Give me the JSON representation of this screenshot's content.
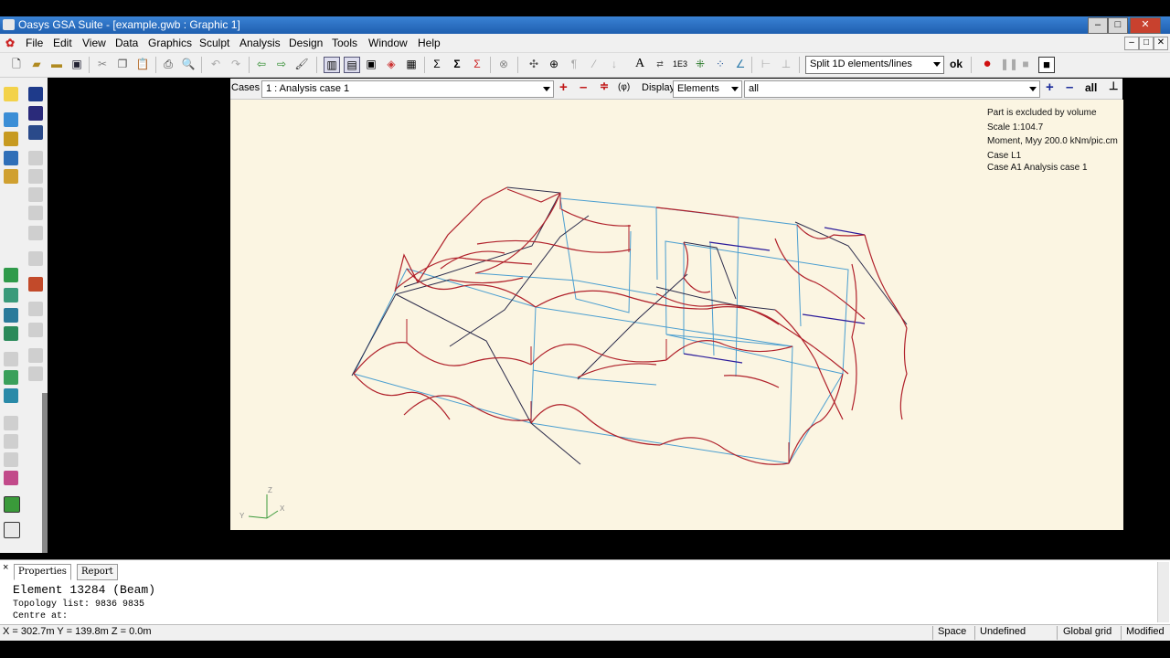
{
  "window": {
    "title": "Oasys GSA Suite - [example.gwb : Graphic 1]",
    "minimize": "–",
    "maximize": "□",
    "close": "✕"
  },
  "menu": [
    "File",
    "Edit",
    "View",
    "Data",
    "Graphics",
    "Sculpt",
    "Analysis",
    "Design",
    "Tools",
    "Window",
    "Help"
  ],
  "toolbar": {
    "split_select": "Split 1D elements/lines",
    "ok_label": "ok",
    "text_tool": "A",
    "grid_value": "1E3",
    "sigma": "Σ"
  },
  "graphic_bar": {
    "cases_label": "Cases",
    "cases_value": "1 : Analysis case 1",
    "display_label": "Display",
    "display_value": "Elements",
    "filter_value": "all",
    "all_label": "all",
    "plus": "+",
    "minus": "–",
    "pin": "⊥"
  },
  "viewport": {
    "info": [
      "Part is excluded by volume",
      "Scale  1:104.7",
      "Moment, Myy  200.0 kNm/pic.cm",
      "Case  L1",
      "Case  A1    Analysis case 1"
    ],
    "axis": {
      "x": "X",
      "y": "Y",
      "z": "Z"
    }
  },
  "bottom_panel": {
    "tabs": [
      "Properties",
      "Report"
    ],
    "close": "×",
    "heading": "Element 13284 (Beam)",
    "line1": "Topology list:   9836  9835",
    "line2": "Centre at:"
  },
  "statusbar": {
    "coords": "X = 302.7m   Y = 139.8m   Z = 0.0m",
    "space": "Space",
    "undefined": "Undefined",
    "grid": "Global grid",
    "modified": "Modified"
  },
  "colors": {
    "viewport_bg": "#fbf5e2",
    "moment_diagram": "#b0202a",
    "element_lines": "#4a9ed0",
    "title_bar": "#2a70c4"
  }
}
